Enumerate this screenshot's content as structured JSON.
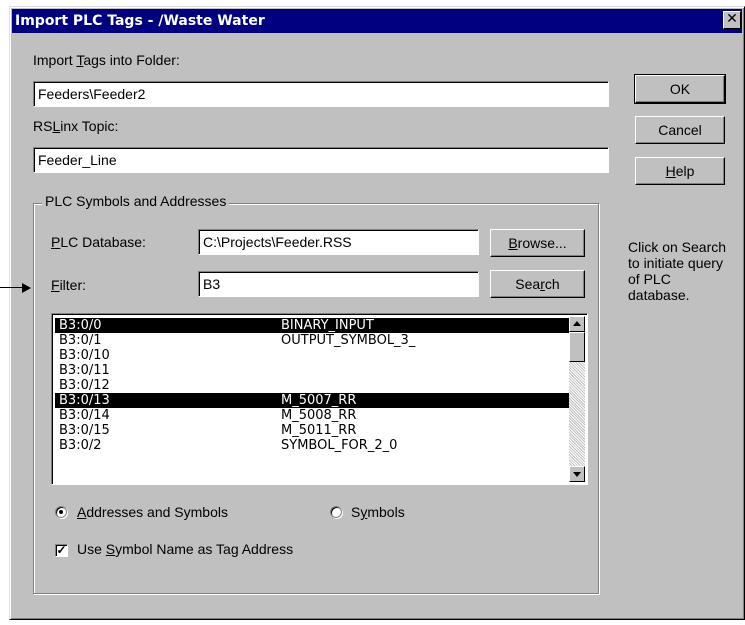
{
  "window": {
    "title": "Import PLC Tags - /Waste Water",
    "close_glyph": "✕"
  },
  "import_folder": {
    "label_pre": "Import ",
    "label_hot": "T",
    "label_post": "ags into Folder:",
    "value": "Feeders\\Feeder2"
  },
  "topic": {
    "label_pre": "RS",
    "label_hot": "L",
    "label_post": "inx Topic:",
    "value": "Feeder_Line"
  },
  "buttons": {
    "ok": "OK",
    "cancel": "Cancel",
    "help_hot": "H",
    "help_post": "elp"
  },
  "group": {
    "title": "PLC Symbols and Addresses",
    "database_label_hot": "P",
    "database_label_post": "LC Database:",
    "database_value": "C:\\Projects\\Feeder.RSS",
    "browse_hot": "B",
    "browse_post": "rowse...",
    "filter_label_hot": "F",
    "filter_label_post": "ilter:",
    "filter_value": "B3",
    "search_pre": "Sea",
    "search_hot": "r",
    "search_post": "ch"
  },
  "list": {
    "rows": [
      {
        "address": "B3:0/0",
        "symbol": "BINARY_INPUT",
        "selected": true
      },
      {
        "address": "B3:0/1",
        "symbol": "OUTPUT_SYMBOL_3_",
        "selected": false
      },
      {
        "address": "B3:0/10",
        "symbol": "",
        "selected": false
      },
      {
        "address": "B3:0/11",
        "symbol": "",
        "selected": false
      },
      {
        "address": "B3:0/12",
        "symbol": "",
        "selected": false
      },
      {
        "address": "B3:0/13",
        "symbol": "M_5007_RR",
        "selected": true
      },
      {
        "address": "B3:0/14",
        "symbol": "M_5008_RR",
        "selected": false
      },
      {
        "address": "B3:0/15",
        "symbol": "M_5011_RR",
        "selected": false
      },
      {
        "address": "B3:0/2",
        "symbol": "SYMBOL_FOR_2_0",
        "selected": false
      }
    ]
  },
  "options": {
    "radio_addresses_hot": "A",
    "radio_addresses_post": "ddresses and Symbols",
    "radio_addresses_checked": true,
    "radio_symbols_pre": "S",
    "radio_symbols_hot": "y",
    "radio_symbols_post": "mbols",
    "radio_symbols_checked": false,
    "checkbox_pre": "Use ",
    "checkbox_hot": "S",
    "checkbox_post": "ymbol Name as Tag Address",
    "checkbox_checked": true,
    "check_glyph": "✓"
  },
  "info_text": "Click on Search to initiate query of PLC database.",
  "colors": {
    "dialog_bg": "#c0c0c0",
    "titlebar_bg": "#000080",
    "selection_bg": "#000000"
  }
}
